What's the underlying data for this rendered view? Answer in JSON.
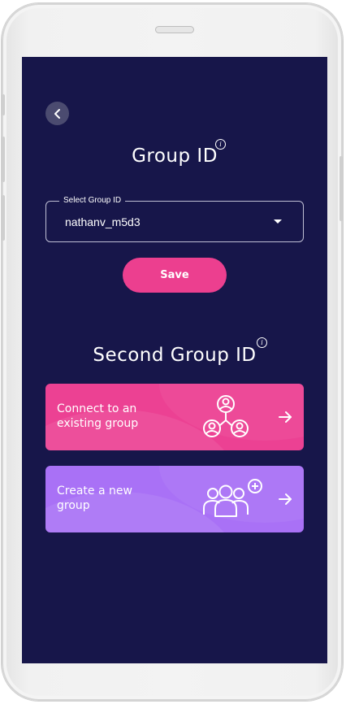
{
  "header": {
    "title": "Group ID",
    "info_symbol": "i"
  },
  "select": {
    "legend": "Select Group ID",
    "value": "nathanv_m5d3"
  },
  "save_button": {
    "label": "Save"
  },
  "second": {
    "title": "Second Group ID",
    "info_symbol": "i"
  },
  "cards": [
    {
      "label": "Connect to an existing group",
      "icon": "connected-users-icon",
      "arrow": "arrow-right-icon",
      "color": "#ec4193"
    },
    {
      "label": "Create a new group",
      "icon": "add-group-icon",
      "arrow": "arrow-right-icon",
      "color": "#a971f6"
    }
  ],
  "colors": {
    "background": "#17164a",
    "accent": "#ec3f8f"
  },
  "icons": {
    "back": "chevron-left-icon"
  }
}
